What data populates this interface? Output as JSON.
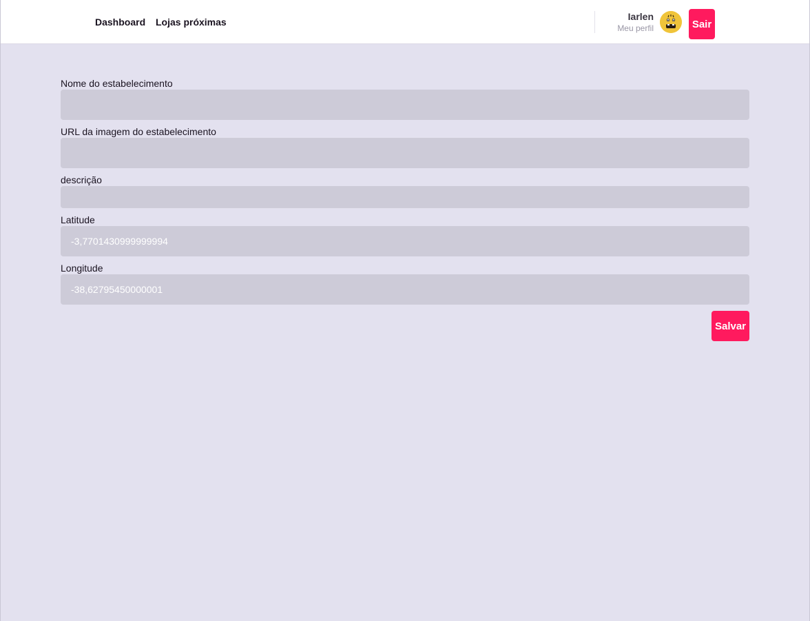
{
  "header": {
    "nav": {
      "dashboard": "Dashboard",
      "lojas_proximas": "Lojas próximas"
    },
    "profile": {
      "name": "Iarlen",
      "link": "Meu perfil",
      "avatar_icon": "avatar-face-icon"
    },
    "logout_label": "Sair"
  },
  "form": {
    "nome": {
      "label": "Nome do estabelecimento",
      "value": ""
    },
    "imagem_url": {
      "label": "URL da imagem do estabelecimento",
      "value": ""
    },
    "descricao": {
      "label": "descrição",
      "value": ""
    },
    "latitude": {
      "label": "Latitude",
      "value": "-3,7701430999999994"
    },
    "longitude": {
      "label": "Longitude",
      "value": "-38,62795450000001"
    },
    "save_label": "Salvar"
  },
  "colors": {
    "accent": "#ff1a5e",
    "background": "#e3e1ef",
    "input_background": "#cdcbd8",
    "header_background": "#ffffff"
  }
}
